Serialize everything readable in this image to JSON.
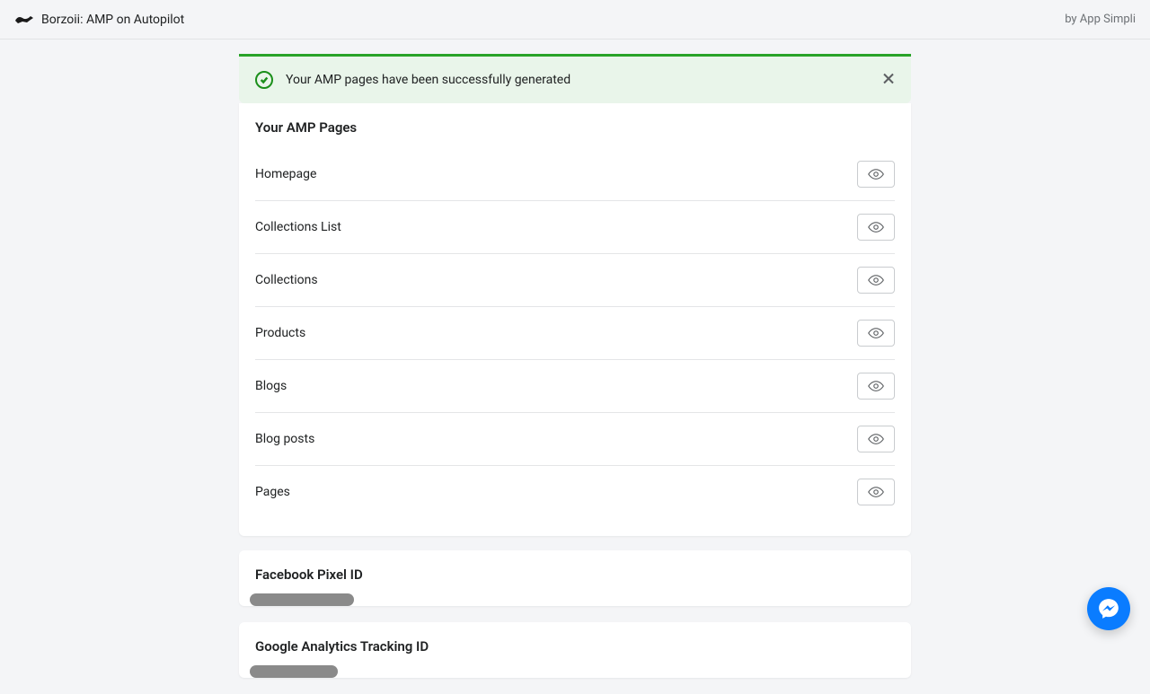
{
  "header": {
    "app_title": "Borzoii: AMP on Autopilot",
    "by_line": "by App Simpli"
  },
  "banner": {
    "message": "Your AMP pages have been successfully generated"
  },
  "amp_pages": {
    "title": "Your AMP Pages",
    "items": [
      {
        "label": "Homepage"
      },
      {
        "label": "Collections List"
      },
      {
        "label": "Collections"
      },
      {
        "label": "Products"
      },
      {
        "label": "Blogs"
      },
      {
        "label": "Blog posts"
      },
      {
        "label": "Pages"
      }
    ]
  },
  "facebook_pixel": {
    "title": "Facebook Pixel ID"
  },
  "google_analytics": {
    "title": "Google Analytics Tracking ID"
  }
}
